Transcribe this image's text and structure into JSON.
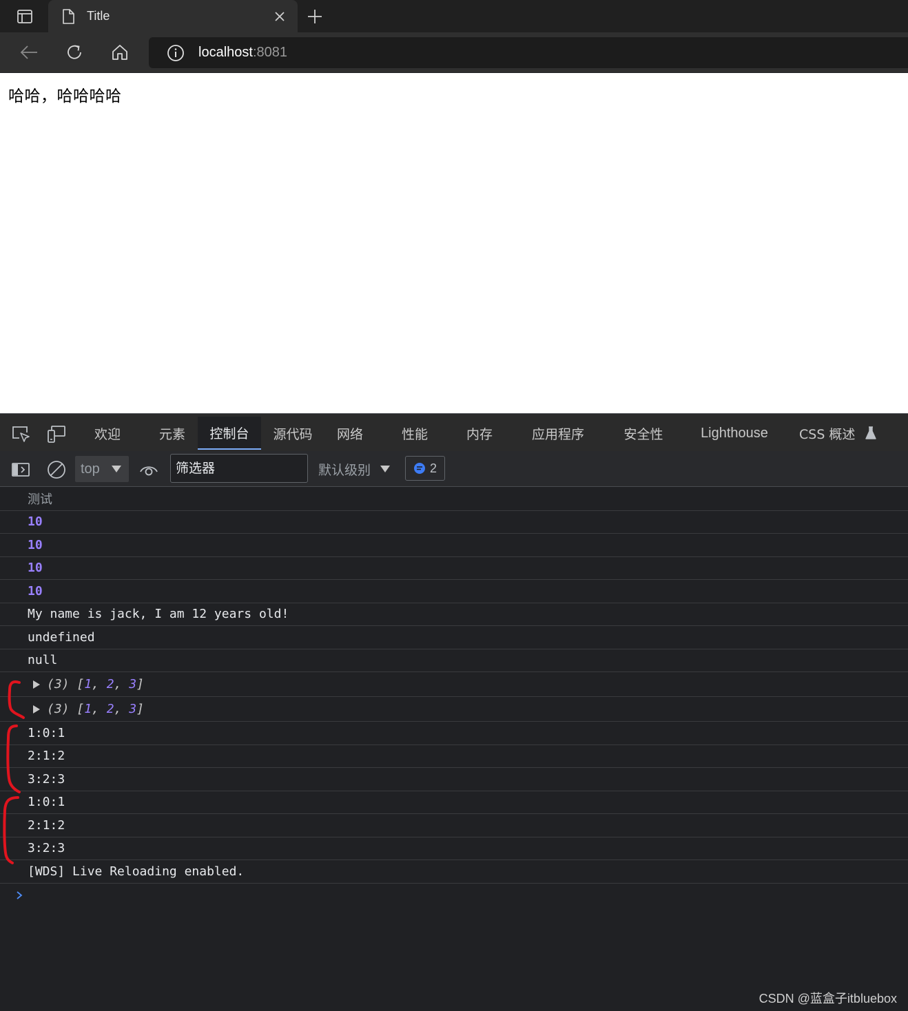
{
  "browser": {
    "tab": {
      "title": "Title"
    },
    "address": {
      "host": "localhost",
      "port": ":8081"
    }
  },
  "page": {
    "body_text": "哈哈，哈哈哈哈"
  },
  "devtools": {
    "tabs": [
      {
        "label": "欢迎"
      },
      {
        "label": "元素"
      },
      {
        "label": "控制台"
      },
      {
        "label": "源代码"
      },
      {
        "label": "网络"
      },
      {
        "label": "性能"
      },
      {
        "label": "内存"
      },
      {
        "label": "应用程序"
      },
      {
        "label": "安全性"
      },
      {
        "label": "Lighthouse"
      },
      {
        "label": "CSS 概述"
      }
    ],
    "active_tab": "控制台",
    "toolbar": {
      "context": "top",
      "filter_placeholder": "筛选器",
      "level": "默认级别",
      "issues_count": "2"
    }
  },
  "console": {
    "entries": [
      {
        "text": "测试"
      },
      {
        "text": "10"
      },
      {
        "text": "10"
      },
      {
        "text": "10"
      },
      {
        "text": "10"
      },
      {
        "text": "My name is jack, I am 12 years old!"
      },
      {
        "text": "undefined"
      },
      {
        "text": "null"
      },
      {
        "count": "(3)",
        "open": "[",
        "a": "1",
        "b": "2",
        "c": "3",
        "close": "]",
        "sep": ", "
      },
      {
        "count": "(3)",
        "open": "[",
        "a": "1",
        "b": "2",
        "c": "3",
        "close": "]",
        "sep": ", "
      },
      {
        "text": "1:0:1"
      },
      {
        "text": "2:1:2"
      },
      {
        "text": "3:2:3"
      },
      {
        "text": "1:0:1"
      },
      {
        "text": "2:1:2"
      },
      {
        "text": "3:2:3"
      },
      {
        "text": "[WDS] Live Reloading enabled."
      }
    ]
  },
  "watermark": "CSDN @蓝盒子itbluebox",
  "colors": {
    "console_number": "#9980ff",
    "active_tab_underline": "#7cacf8",
    "annotation_red": "#e0141e",
    "issue_icon": "#3d7cf5"
  }
}
